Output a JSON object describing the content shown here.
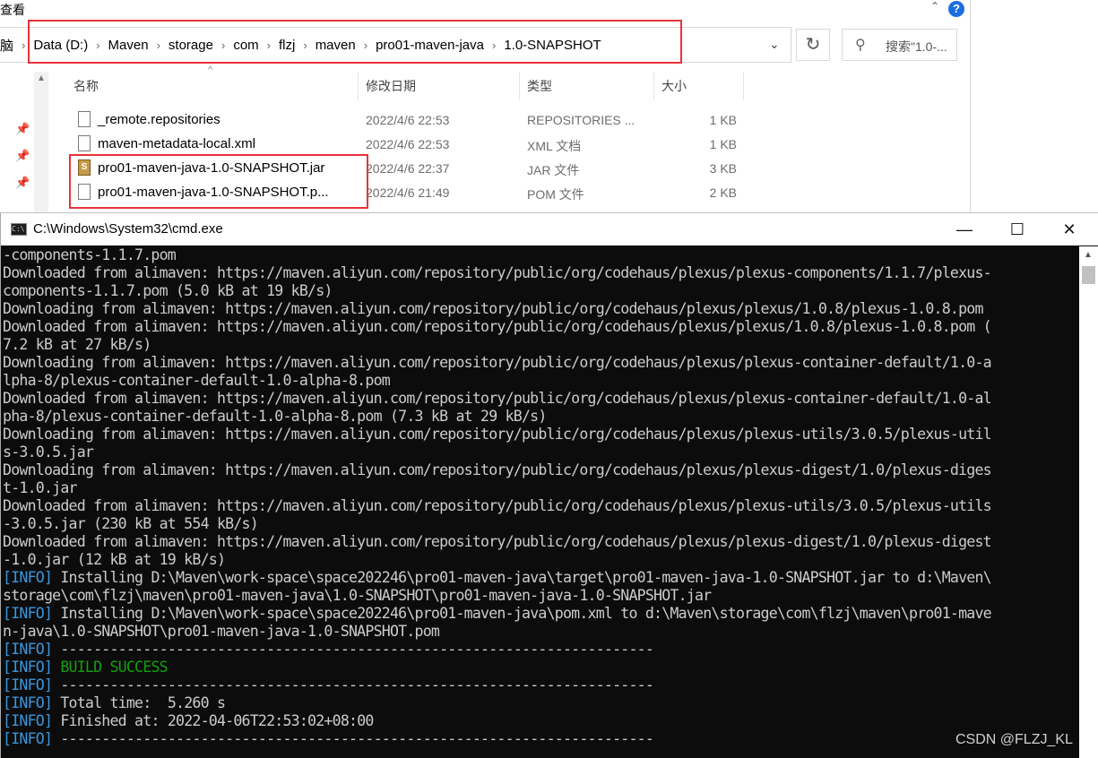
{
  "explorer": {
    "menu_view": "查看",
    "help_icon": "?",
    "address_prefix": "脑",
    "breadcrumbs": [
      "Data (D:)",
      "Maven",
      "storage",
      "com",
      "flzj",
      "maven",
      "pro01-maven-java",
      "1.0-SNAPSHOT"
    ],
    "search_placeholder": "搜索\"1.0-...",
    "columns": {
      "name": "名称",
      "modified": "修改日期",
      "type": "类型",
      "size": "大小"
    },
    "files": [
      {
        "name": "_remote.repositories",
        "modified": "2022/4/6 22:53",
        "type": "REPOSITORIES ...",
        "size": "1 KB",
        "icon": "file-icon"
      },
      {
        "name": "maven-metadata-local.xml",
        "modified": "2022/4/6 22:53",
        "type": "XML 文档",
        "size": "1 KB",
        "icon": "file-icon"
      },
      {
        "name": "pro01-maven-java-1.0-SNAPSHOT.jar",
        "modified": "2022/4/6 22:37",
        "type": "JAR 文件",
        "size": "3 KB",
        "icon": "jar-icon"
      },
      {
        "name": "pro01-maven-java-1.0-SNAPSHOT.p...",
        "modified": "2022/4/6 21:49",
        "type": "POM 文件",
        "size": "2 KB",
        "icon": "file-icon"
      }
    ]
  },
  "cmd": {
    "title": "C:\\Windows\\System32\\cmd.exe",
    "lines": [
      {
        "prefix": "",
        "text": "-components-1.1.7.pom"
      },
      {
        "prefix": "",
        "text": "Downloaded from alimaven: https://maven.aliyun.com/repository/public/org/codehaus/plexus/plexus-components/1.1.7/plexus-"
      },
      {
        "prefix": "",
        "text": "components-1.1.7.pom (5.0 kB at 19 kB/s)"
      },
      {
        "prefix": "",
        "text": "Downloading from alimaven: https://maven.aliyun.com/repository/public/org/codehaus/plexus/plexus/1.0.8/plexus-1.0.8.pom"
      },
      {
        "prefix": "",
        "text": "Downloaded from alimaven: https://maven.aliyun.com/repository/public/org/codehaus/plexus/plexus/1.0.8/plexus-1.0.8.pom ("
      },
      {
        "prefix": "",
        "text": "7.2 kB at 27 kB/s)"
      },
      {
        "prefix": "",
        "text": "Downloading from alimaven: https://maven.aliyun.com/repository/public/org/codehaus/plexus/plexus-container-default/1.0-a"
      },
      {
        "prefix": "",
        "text": "lpha-8/plexus-container-default-1.0-alpha-8.pom"
      },
      {
        "prefix": "",
        "text": "Downloaded from alimaven: https://maven.aliyun.com/repository/public/org/codehaus/plexus/plexus-container-default/1.0-al"
      },
      {
        "prefix": "",
        "text": "pha-8/plexus-container-default-1.0-alpha-8.pom (7.3 kB at 29 kB/s)"
      },
      {
        "prefix": "",
        "text": "Downloading from alimaven: https://maven.aliyun.com/repository/public/org/codehaus/plexus/plexus-utils/3.0.5/plexus-util"
      },
      {
        "prefix": "",
        "text": "s-3.0.5.jar"
      },
      {
        "prefix": "",
        "text": "Downloading from alimaven: https://maven.aliyun.com/repository/public/org/codehaus/plexus/plexus-digest/1.0/plexus-diges"
      },
      {
        "prefix": "",
        "text": "t-1.0.jar"
      },
      {
        "prefix": "",
        "text": "Downloaded from alimaven: https://maven.aliyun.com/repository/public/org/codehaus/plexus/plexus-utils/3.0.5/plexus-utils"
      },
      {
        "prefix": "",
        "text": "-3.0.5.jar (230 kB at 554 kB/s)"
      },
      {
        "prefix": "",
        "text": "Downloaded from alimaven: https://maven.aliyun.com/repository/public/org/codehaus/plexus/plexus-digest/1.0/plexus-digest"
      },
      {
        "prefix": "",
        "text": "-1.0.jar (12 kB at 19 kB/s)"
      },
      {
        "prefix": "[INFO]",
        "text": " Installing D:\\Maven\\work-space\\space202246\\pro01-maven-java\\target\\pro01-maven-java-1.0-SNAPSHOT.jar to d:\\Maven\\"
      },
      {
        "prefix": "",
        "text": "storage\\com\\flzj\\maven\\pro01-maven-java\\1.0-SNAPSHOT\\pro01-maven-java-1.0-SNAPSHOT.jar"
      },
      {
        "prefix": "[INFO]",
        "text": " Installing D:\\Maven\\work-space\\space202246\\pro01-maven-java\\pom.xml to d:\\Maven\\storage\\com\\flzj\\maven\\pro01-mave"
      },
      {
        "prefix": "",
        "text": "n-java\\1.0-SNAPSHOT\\pro01-maven-java-1.0-SNAPSHOT.pom"
      },
      {
        "prefix": "[INFO]",
        "text": " ------------------------------------------------------------------------"
      },
      {
        "prefix": "[INFO]",
        "text": " BUILD SUCCESS",
        "success": true
      },
      {
        "prefix": "[INFO]",
        "text": " ------------------------------------------------------------------------"
      },
      {
        "prefix": "[INFO]",
        "text": " Total time:  5.260 s"
      },
      {
        "prefix": "[INFO]",
        "text": " Finished at: 2022-04-06T22:53:02+08:00"
      },
      {
        "prefix": "[INFO]",
        "text": " ------------------------------------------------------------------------"
      }
    ]
  },
  "watermark": "CSDN @FLZJ_KL",
  "colors": {
    "highlight": "#e8333a",
    "info": "#3a96dd",
    "success": "#13a10e",
    "console_bg": "#0c0c0c"
  }
}
